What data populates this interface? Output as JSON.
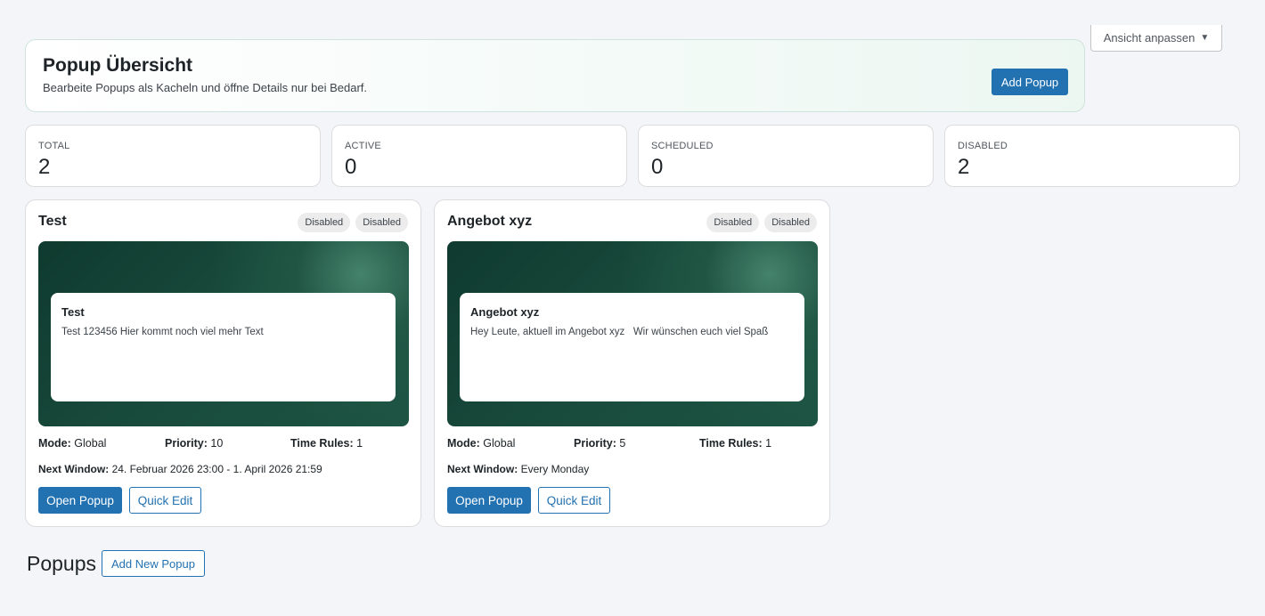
{
  "screen_options": {
    "label": "Ansicht anpassen",
    "caret_icon": "triangle-down-icon"
  },
  "header": {
    "title": "Popup Übersicht",
    "subtitle": "Bearbeite Popups als Kacheln und öffne Details nur bei Bedarf.",
    "add_button": "Add Popup"
  },
  "stats": [
    {
      "label": "TOTAL",
      "value": "2"
    },
    {
      "label": "ACTIVE",
      "value": "0"
    },
    {
      "label": "SCHEDULED",
      "value": "0"
    },
    {
      "label": "DISABLED",
      "value": "2"
    }
  ],
  "popups": [
    {
      "title": "Test",
      "badges": [
        "Disabled",
        "Disabled"
      ],
      "preview_title": "Test",
      "preview_text": "Test 123456 Hier kommt noch viel mehr Text",
      "mode_label": "Mode:",
      "mode_value": "Global",
      "priority_label": "Priority:",
      "priority_value": "10",
      "time_rules_label": "Time Rules:",
      "time_rules_value": "1",
      "next_window_label": "Next Window:",
      "next_window_value": "24. Februar 2026 23:00 - 1. April 2026 21:59",
      "open_label": "Open Popup",
      "quick_edit_label": "Quick Edit"
    },
    {
      "title": "Angebot xyz",
      "badges": [
        "Disabled",
        "Disabled"
      ],
      "preview_title": "Angebot xyz",
      "preview_text": "Hey Leute, aktuell im Angebot xyz   Wir wünschen euch viel Spaß",
      "mode_label": "Mode:",
      "mode_value": "Global",
      "priority_label": "Priority:",
      "priority_value": "5",
      "time_rules_label": "Time Rules:",
      "time_rules_value": "1",
      "next_window_label": "Next Window:",
      "next_window_value": "Every Monday",
      "open_label": "Open Popup",
      "quick_edit_label": "Quick Edit"
    }
  ],
  "list": {
    "heading": "Popups",
    "add_new_button": "Add New Popup"
  },
  "colors": {
    "primary": "#2271b1",
    "preview_dark": "#0f3a2f",
    "preview_glow": "#4c8c74",
    "page_bg": "#f4f5f9"
  }
}
